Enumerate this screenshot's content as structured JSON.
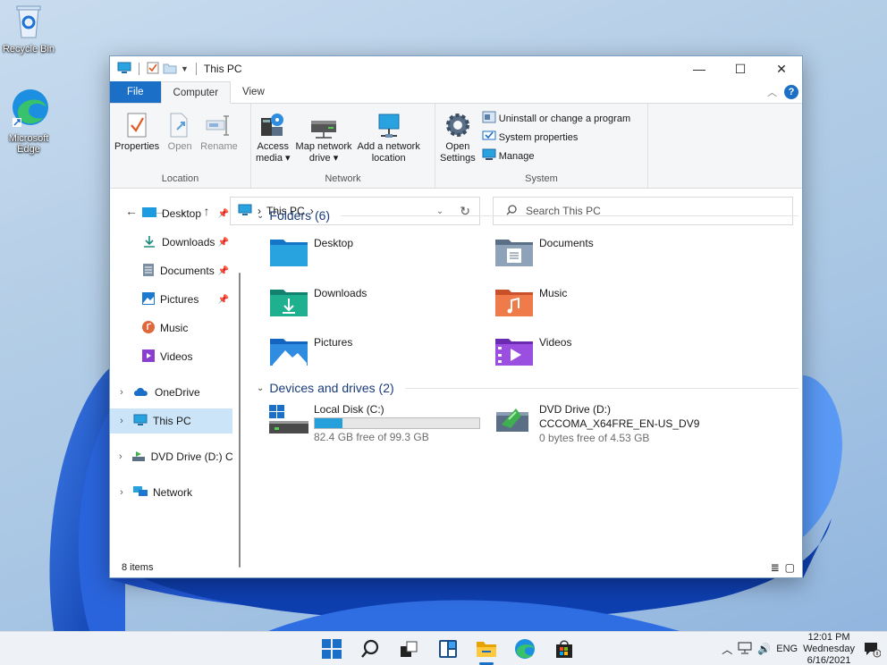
{
  "desktop": {
    "icons": [
      {
        "label": "Recycle Bin"
      },
      {
        "label": "Microsoft Edge"
      }
    ]
  },
  "window": {
    "title": "This PC",
    "tabs": {
      "file": "File",
      "computer": "Computer",
      "view": "View"
    },
    "help_label": "?"
  },
  "ribbon": {
    "location": {
      "label": "Location",
      "properties": "Properties",
      "open": "Open",
      "rename": "Rename"
    },
    "network": {
      "label": "Network",
      "access_media_1": "Access",
      "access_media_2": "media ▾",
      "map_drive_1": "Map network",
      "map_drive_2": "drive ▾",
      "add_location_1": "Add a network",
      "add_location_2": "location"
    },
    "system": {
      "label": "System",
      "open_settings_1": "Open",
      "open_settings_2": "Settings",
      "uninstall": "Uninstall or change a program",
      "system_properties": "System properties",
      "manage": "Manage"
    }
  },
  "address": {
    "path": "This PC",
    "search_placeholder": "Search This PC"
  },
  "nav_pane": {
    "items": [
      {
        "label": "Desktop",
        "pinned": true
      },
      {
        "label": "Downloads",
        "pinned": true
      },
      {
        "label": "Documents",
        "pinned": true
      },
      {
        "label": "Pictures",
        "pinned": true
      },
      {
        "label": "Music",
        "pinned": false
      },
      {
        "label": "Videos",
        "pinned": false
      },
      {
        "label": "OneDrive",
        "pinned": false
      },
      {
        "label": "This PC",
        "pinned": false
      },
      {
        "label": "DVD Drive (D:) CC",
        "pinned": false
      },
      {
        "label": "Network",
        "pinned": false
      }
    ]
  },
  "main": {
    "folders_header": "Folders (6)",
    "folders": [
      {
        "label": "Desktop"
      },
      {
        "label": "Documents"
      },
      {
        "label": "Downloads"
      },
      {
        "label": "Music"
      },
      {
        "label": "Pictures"
      },
      {
        "label": "Videos"
      }
    ],
    "drives_header": "Devices and drives (2)",
    "drives": [
      {
        "name": "Local Disk (C:)",
        "free": "82.4 GB free of 99.3 GB",
        "used_fraction": 0.17
      },
      {
        "name": "DVD Drive (D:)",
        "volume": "CCCOMA_X64FRE_EN-US_DV9",
        "free": "0 bytes free of 4.53 GB"
      }
    ]
  },
  "status": {
    "items": "8 items"
  },
  "taskbar": {
    "lang": "ENG",
    "time": "12:01 PM",
    "day": "Wednesday",
    "date": "6/16/2021"
  },
  "colors": {
    "accent": "#1b6fc7",
    "selection": "#cce4f7",
    "drive_fill": "#26a0da"
  }
}
